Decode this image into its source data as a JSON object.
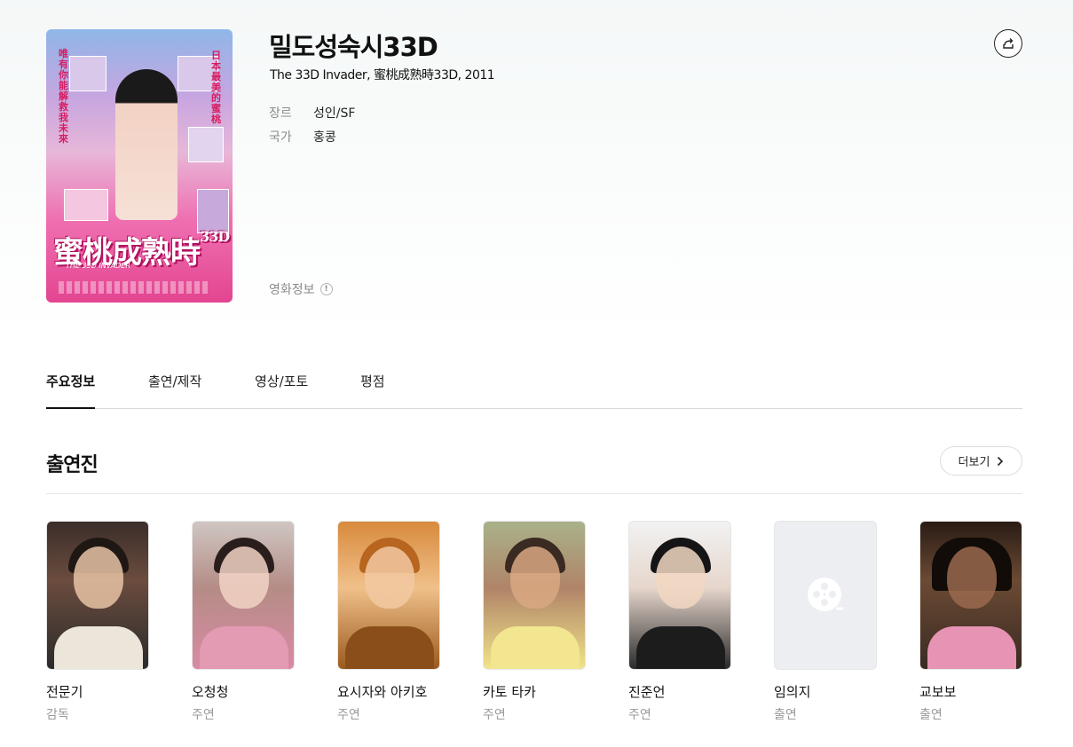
{
  "movie": {
    "title": "밀도성숙시33D",
    "subtitle": "The 33D Invader, 蜜桃成熟時33D, 2011",
    "genre_label": "장르",
    "genre_value": "성인/SF",
    "country_label": "국가",
    "country_value": "홍콩",
    "movie_info_label": "영화정보",
    "info_badge": "!",
    "poster": {
      "logo_text": "蜜桃成熟時",
      "logo_3d": "33D",
      "logo_sub": "THE 33D INVADER",
      "left_vertical_text": "唯有你能解救我未來",
      "right_vertical_text": "日本最美的蜜桃"
    }
  },
  "tabs": [
    {
      "label": "주요정보",
      "active": true
    },
    {
      "label": "출연/제작",
      "active": false
    },
    {
      "label": "영상/포토",
      "active": false
    },
    {
      "label": "평점",
      "active": false
    }
  ],
  "cast_section": {
    "title": "출연진",
    "more_label": "더보기"
  },
  "cast": [
    {
      "name": "전문기",
      "role": "감독"
    },
    {
      "name": "오청청",
      "role": "주연"
    },
    {
      "name": "요시자와 아키호",
      "role": "주연"
    },
    {
      "name": "카토 타카",
      "role": "주연"
    },
    {
      "name": "진준언",
      "role": "주연"
    },
    {
      "name": "임의지",
      "role": "출연"
    },
    {
      "name": "교보보",
      "role": "출연"
    }
  ],
  "colors": {
    "text_primary": "#111111",
    "text_secondary": "#8a8a8a",
    "poster_pink": "#e34591",
    "divider": "#d9d9d9"
  }
}
